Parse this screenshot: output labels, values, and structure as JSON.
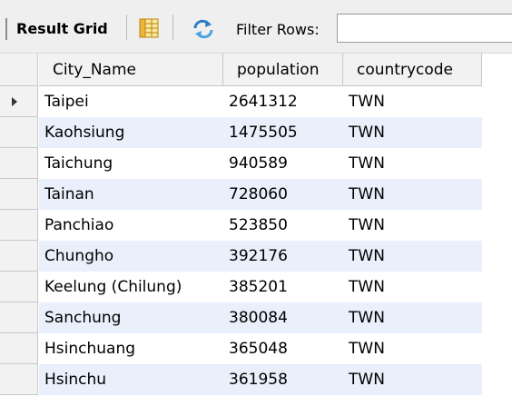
{
  "toolbar": {
    "title": "Result Grid",
    "filter_label": "Filter Rows:",
    "filter_value": ""
  },
  "grid": {
    "columns": [
      "City_Name",
      "population",
      "countrycode"
    ],
    "rows": [
      [
        "Taipei",
        "2641312",
        "TWN"
      ],
      [
        "Kaohsiung",
        "1475505",
        "TWN"
      ],
      [
        "Taichung",
        "940589",
        "TWN"
      ],
      [
        "Tainan",
        "728060",
        "TWN"
      ],
      [
        "Panchiao",
        "523850",
        "TWN"
      ],
      [
        "Chungho",
        "392176",
        "TWN"
      ],
      [
        "Keelung (Chilung)",
        "385201",
        "TWN"
      ],
      [
        "Sanchung",
        "380084",
        "TWN"
      ],
      [
        "Hsinchuang",
        "365048",
        "TWN"
      ],
      [
        "Hsinchu",
        "361958",
        "TWN"
      ]
    ],
    "current_row": 0
  },
  "colors": {
    "stripe": "#e9f0fb",
    "toolbar_bg": "#efefef",
    "header_bg": "#f2f2f2"
  },
  "icons": {
    "grid_view": "grid-view-icon",
    "refresh": "refresh-icon",
    "current_row": "current-row-arrow-icon"
  }
}
